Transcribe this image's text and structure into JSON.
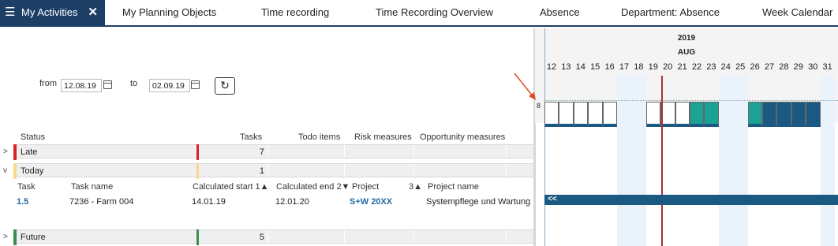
{
  "tabs": [
    {
      "label": "My Activities"
    },
    {
      "label": "My Planning Objects"
    },
    {
      "label": "Time recording"
    },
    {
      "label": "Time Recording Overview"
    },
    {
      "label": "Absence"
    },
    {
      "label": "Department: Absence"
    },
    {
      "label": "Week Calendar"
    }
  ],
  "icons": {
    "menu": "☰",
    "close": "✕",
    "refresh": "↻"
  },
  "filter": {
    "from_label": "from",
    "from_value": "12.08.19",
    "to_label": "to",
    "to_value": "02.09.19"
  },
  "summary_headers": [
    "Status",
    "Tasks",
    "Todo items",
    "Risk measures",
    "Opportunity measures"
  ],
  "groups": [
    {
      "label": "Late",
      "tasks": "7",
      "color": "#d9232a",
      "chevron": ">"
    },
    {
      "label": "Today",
      "tasks": "1",
      "color": "#f6d98a",
      "chevron": "v"
    },
    {
      "label": "Future",
      "tasks": "5",
      "color": "#3d8b4f",
      "chevron": ">"
    }
  ],
  "detail_headers": [
    "Task",
    "Task name",
    "Calculated start 1▲",
    "Calculated end 2▼",
    "Project",
    "3▲",
    "Project name"
  ],
  "detail_row": {
    "task": "1.5",
    "task_name": "7236 - Farm 004",
    "start": "14.01.19",
    "end": "12.01.20",
    "project": "S+W 20XX",
    "project_name": "Systempflege und Wartung"
  },
  "gantt": {
    "year": "2019",
    "month": "AUG",
    "days": [
      "12",
      "13",
      "14",
      "15",
      "16",
      "17",
      "18",
      "19",
      "20",
      "21",
      "22",
      "23",
      "24",
      "25",
      "26",
      "27",
      "28",
      "29",
      "30",
      "31"
    ],
    "row_label": "8",
    "marker": "<<",
    "colors": {
      "accent": "#1d3f66",
      "teal": "#1aa394",
      "dark_blue": "#1a5a82",
      "weekend": "#eaf2fb",
      "today_line": "#b03030"
    }
  }
}
